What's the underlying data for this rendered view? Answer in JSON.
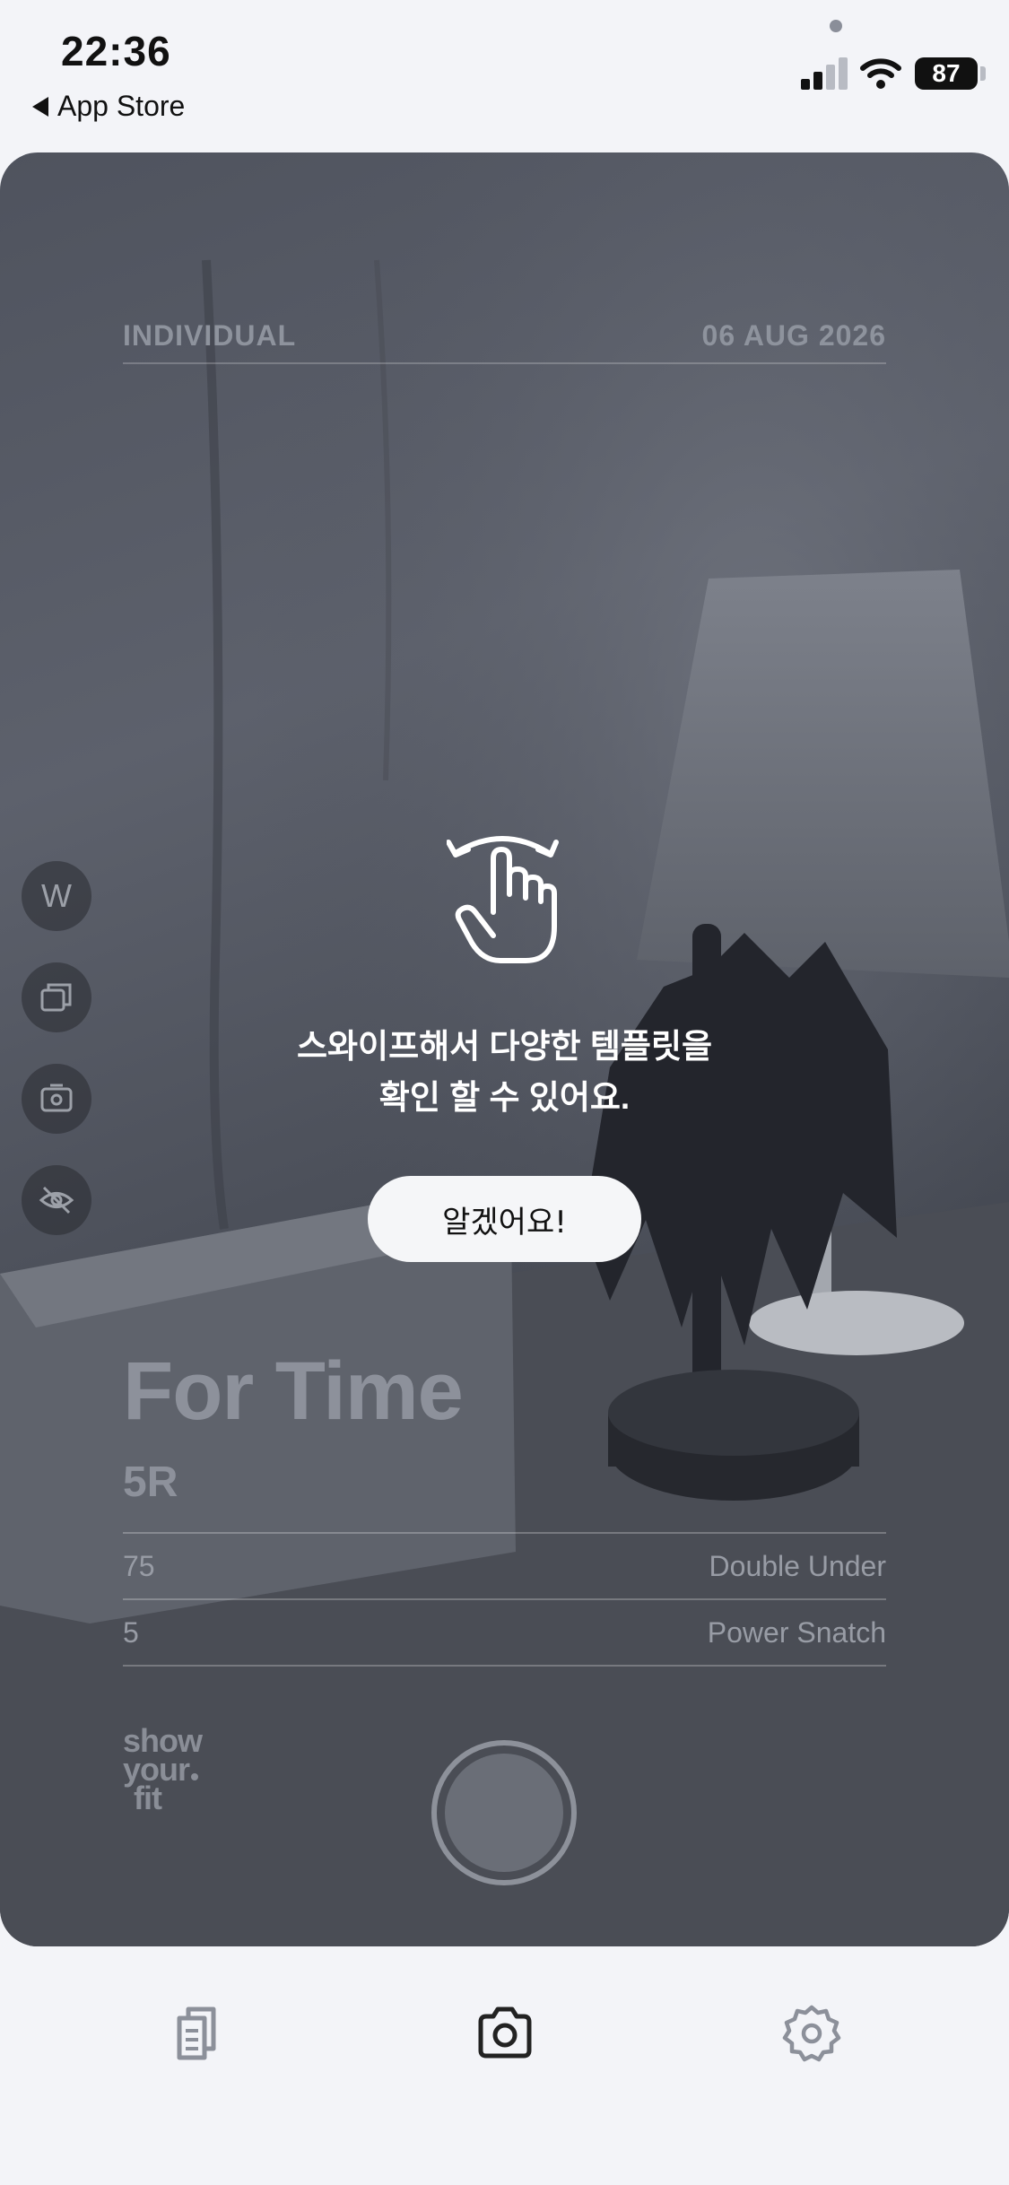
{
  "status_bar": {
    "time": "22:36",
    "back_label": "App Store",
    "battery": "87"
  },
  "card": {
    "mode": "INDIVIDUAL",
    "date": "06 AUG 2026",
    "side_tools": [
      {
        "icon": "w-letter-icon",
        "label": "W"
      },
      {
        "icon": "stack-icon",
        "label": ""
      },
      {
        "icon": "camera-switch-icon",
        "label": ""
      },
      {
        "icon": "eye-off-icon",
        "label": ""
      }
    ],
    "workout": {
      "title": "For Time",
      "rounds": "5R",
      "movements": [
        {
          "reps": "75",
          "name": "Double Under"
        },
        {
          "reps": "5",
          "name": "Power Snatch"
        }
      ]
    },
    "logo_lines": [
      "show",
      "your",
      "fit"
    ]
  },
  "guide": {
    "line1": "스와이프해서 다양한 템플릿을",
    "line2": "확인 할 수 있어요.",
    "button": "알겠어요!"
  },
  "tab_bar": {
    "tabs": [
      {
        "icon": "document-icon",
        "active": false
      },
      {
        "icon": "camera-icon",
        "active": true
      },
      {
        "icon": "gear-icon",
        "active": false
      }
    ]
  }
}
